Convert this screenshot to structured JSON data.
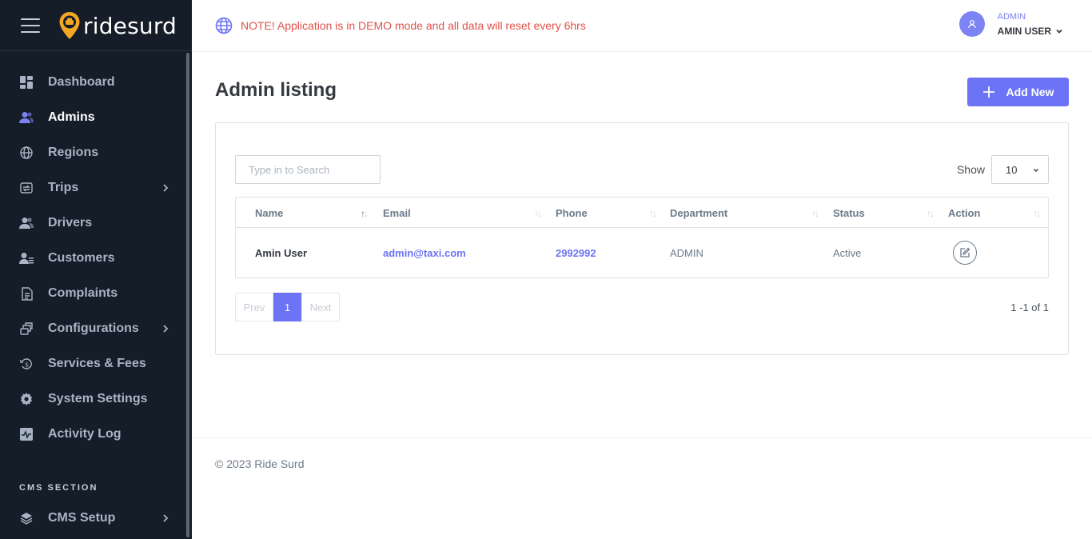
{
  "brand": {
    "name": "ridesurd"
  },
  "sidebar": {
    "items": [
      {
        "label": "Dashboard",
        "icon": "dashboard-icon"
      },
      {
        "label": "Admins",
        "icon": "users-icon",
        "active": true
      },
      {
        "label": "Regions",
        "icon": "globe-icon"
      },
      {
        "label": "Trips",
        "icon": "trips-icon",
        "has_children": true
      },
      {
        "label": "Drivers",
        "icon": "drivers-icon"
      },
      {
        "label": "Customers",
        "icon": "customers-icon"
      },
      {
        "label": "Complaints",
        "icon": "complaints-icon"
      },
      {
        "label": "Configurations",
        "icon": "configurations-icon",
        "has_children": true
      },
      {
        "label": "Services & Fees",
        "icon": "services-icon"
      },
      {
        "label": "System Settings",
        "icon": "settings-icon"
      },
      {
        "label": "Activity Log",
        "icon": "activity-icon"
      }
    ],
    "cms_section_title": "CMS SECTION",
    "cms_items": [
      {
        "label": "CMS Setup",
        "icon": "layers-icon",
        "has_children": true
      }
    ]
  },
  "topbar": {
    "notice": "NOTE! Application is in DEMO mode and all data will reset every 6hrs",
    "user_role": "ADMIN",
    "user_name": "AMIN USER"
  },
  "main": {
    "title": "Admin listing",
    "add_button": "Add New",
    "search_placeholder": "Type in to Search",
    "show_label": "Show",
    "page_size": "10",
    "columns": [
      "Name",
      "Email",
      "Phone",
      "Department",
      "Status",
      "Action"
    ],
    "rows": [
      {
        "name": "Amin User",
        "email": "admin@taxi.com",
        "phone": "2992992",
        "department": "ADMIN",
        "status": "Active"
      }
    ],
    "pagination": {
      "prev": "Prev",
      "current": "1",
      "next": "Next",
      "summary": "1 -1 of 1"
    }
  },
  "footer": {
    "text": "© 2023 Ride Surd"
  },
  "colors": {
    "sidebar_bg": "#151d28",
    "accent": "#6c74f5",
    "notice": "#e0524a"
  }
}
